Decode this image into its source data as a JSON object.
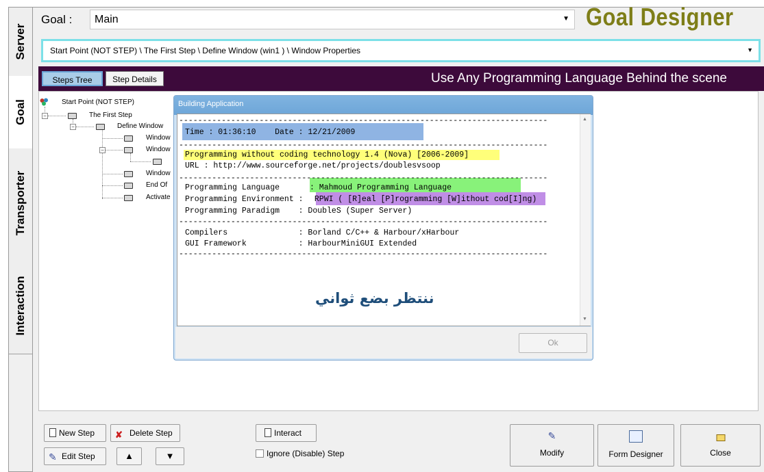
{
  "vertical_tabs": [
    "Server",
    "Goal",
    "Transporter",
    "Interaction"
  ],
  "goal": {
    "label": "Goal :",
    "value": "Main"
  },
  "brand": "Goal Designer",
  "path": "Start Point (NOT STEP) \\ The First Step \\ Define Window  (win1 ) \\ Window Properties",
  "tabs": {
    "steps_tree": "Steps Tree",
    "step_details": "Step Details"
  },
  "banner": "Use Any Programming Language Behind the scene",
  "tree": {
    "root": "Start Point (NOT STEP)",
    "first_step": "The First Step",
    "define_window": "Define Window",
    "window1": "Window",
    "window2": "Window",
    "window3": "Window",
    "end_of": "End Of",
    "activate": "Activate"
  },
  "dialog": {
    "title": "Building Application",
    "dash_line": "------------------------------------------------------------------------------",
    "time_line": "Time : 01:36:10    Date : 12/21/2009",
    "pwct_line": "Programming without coding technology 1.4 (Nova) [2006-2009]",
    "url_line": "URL : http://www.sourceforge.net/projects/doublesvsoop",
    "lang_label": "Programming Language    ",
    "lang_value": ": Mahmoud Programming Language",
    "env_label": "Programming Environment :",
    "env_value": " RPWI ( [R]eal [P]rogramming [W]ithout cod[I]ng)",
    "paradigm_line": "Programming Paradigm    : DoubleS (Super Server)",
    "compilers_line": "Compilers               : Borland C/C++ & Harbour/xHarbour",
    "gui_line": "GUI Framework           : HarbourMiniGUI Extended",
    "arabic": "ننتظر بضع ثواني",
    "ok": "Ok"
  },
  "buttons": {
    "new_step": "New Step",
    "delete_step": "Delete Step",
    "edit_step": "Edit Step",
    "interact": "Interact",
    "ignore": "Ignore (Disable) Step",
    "modify": "Modify",
    "form_designer": "Form Designer",
    "close": "Close"
  },
  "colors": {
    "highlight_blue": "#8fb4e3",
    "highlight_yellow": "#ffff7a",
    "highlight_green": "#88f27a",
    "highlight_purple": "#c08ee6",
    "banner_bg": "#3d0a3b",
    "brand": "#7e7e18"
  }
}
